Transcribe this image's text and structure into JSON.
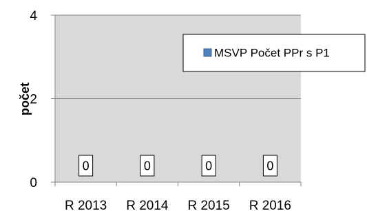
{
  "chart_data": {
    "type": "bar",
    "categories": [
      "R 2013",
      "R 2014",
      "R 2015",
      "R 2016"
    ],
    "series": [
      {
        "name": "MSVP Počet PPr s P1",
        "values": [
          0,
          0,
          0,
          0
        ],
        "color": "#4F81BD"
      }
    ],
    "data_labels": [
      "0",
      "0",
      "0",
      "0"
    ],
    "ylabel": "počet",
    "ylim": [
      0,
      4
    ],
    "yticks": [
      "0",
      "2",
      "4"
    ],
    "plot_background": "#D9D9D9",
    "grid": true,
    "legend_position": "top-right"
  }
}
